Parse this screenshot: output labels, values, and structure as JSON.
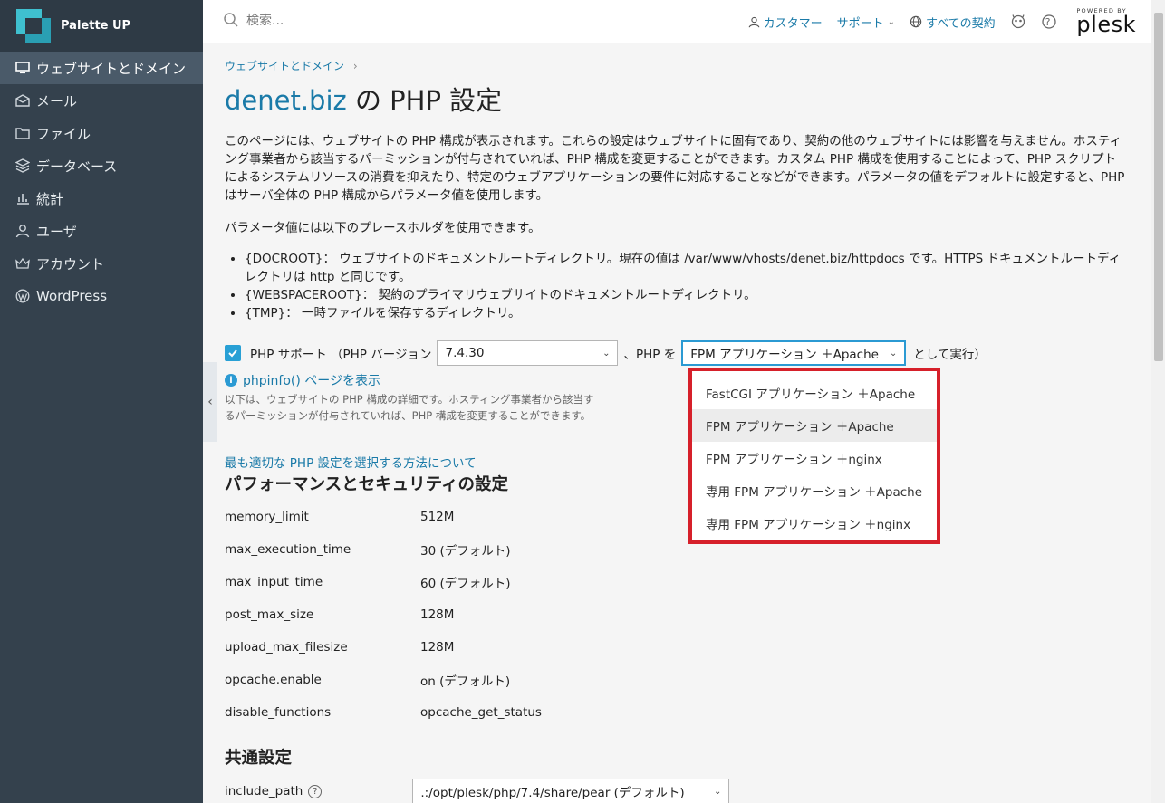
{
  "brand": {
    "name": "Palette UP"
  },
  "sidebar": {
    "items": [
      {
        "label": "ウェブサイトとドメイン",
        "icon": "monitor-icon"
      },
      {
        "label": "メール",
        "icon": "mail-icon"
      },
      {
        "label": "ファイル",
        "icon": "folder-icon"
      },
      {
        "label": "データベース",
        "icon": "database-icon"
      },
      {
        "label": "統計",
        "icon": "bar-chart-icon"
      },
      {
        "label": "ユーザ",
        "icon": "user-icon"
      },
      {
        "label": "アカウント",
        "icon": "crown-icon"
      },
      {
        "label": "WordPress",
        "icon": "wordpress-icon"
      }
    ],
    "collapse_glyph": "‹"
  },
  "header": {
    "search_placeholder": "検索...",
    "customer": "カスタマー",
    "support": "サポート",
    "subscriptions": "すべての契約",
    "help_glyph": "?",
    "powered_by": "POWERED BY",
    "plesk": "plesk"
  },
  "page": {
    "breadcrumb": "ウェブサイトとドメイン",
    "breadcrumb_sep": "›",
    "title_domain": "denet.biz",
    "title_rest": " の PHP 設定",
    "intro": "このページには、ウェブサイトの PHP 構成が表示されます。これらの設定はウェブサイトに固有であり、契約の他のウェブサイトには影響を与えません。ホスティング事業者から該当するパーミッションが付与されていれば、PHP 構成を変更することができます。カスタム PHP 構成を使用することによって、PHP スクリプトによるシステムリソースの消費を抑えたり、特定のウェブアプリケーションの要件に対応することなどができます。パラメータの値をデフォルトに設定すると、PHP はサーバ全体の PHP 構成からパラメータ値を使用します。",
    "placeholder_intro": "パラメータ値には以下のプレースホルダを使用できます。",
    "placeholders": [
      "{DOCROOT}： ウェブサイトのドキュメントルートディレクトリ。現在の値は /var/www/vhosts/denet.biz/httpdocs です。HTTPS ドキュメントルートディレクトリは http と同じです。",
      "{WEBSPACEROOT}： 契約のプライマリウェブサイトのドキュメントルートディレクトリ。",
      "{TMP}： 一時ファイルを保存するディレクトリ。"
    ],
    "php_support_label": "PHP サポート （PHP バージョン",
    "php_version": "7.4.30",
    "php_as_label": "、PHP を",
    "php_handler": "FPM アプリケーション ＋Apache",
    "run_as_label": "として実行）",
    "handler_options": [
      "FastCGI アプリケーション ＋Apache",
      "FPM アプリケーション ＋Apache",
      "FPM アプリケーション ＋nginx",
      "専用 FPM アプリケーション ＋Apache",
      "専用 FPM アプリケーション ＋nginx"
    ],
    "selected_option_index": 1,
    "phpinfo_link": "phpinfo() ページを表示",
    "hint": "以下は、ウェブサイトの PHP 構成の詳細です。ホスティング事業者から該当するパーミッションが付与されていれば、PHP 構成を変更することができます。",
    "howto_link": "最も適切な PHP 設定を選択する方法について",
    "section_perf": "パフォーマンスとセキュリティの設定",
    "params": [
      {
        "key": "memory_limit",
        "value": "512M"
      },
      {
        "key": "max_execution_time",
        "value": "30 (デフォルト)"
      },
      {
        "key": "max_input_time",
        "value": "60 (デフォルト)"
      },
      {
        "key": "post_max_size",
        "value": "128M"
      },
      {
        "key": "upload_max_filesize",
        "value": "128M"
      },
      {
        "key": "opcache.enable",
        "value": "on (デフォルト)"
      },
      {
        "key": "disable_functions",
        "value": "opcache_get_status"
      }
    ],
    "section_common": "共通設定",
    "include_path_label": "include_path",
    "include_path_value": ".:/opt/plesk/php/7.4/share/pear (デフォルト)"
  },
  "colors": {
    "accent": "#1a7aa8",
    "sidebar": "#34414d",
    "highlight": "#d6202a",
    "checkbox": "#28a0d5"
  }
}
